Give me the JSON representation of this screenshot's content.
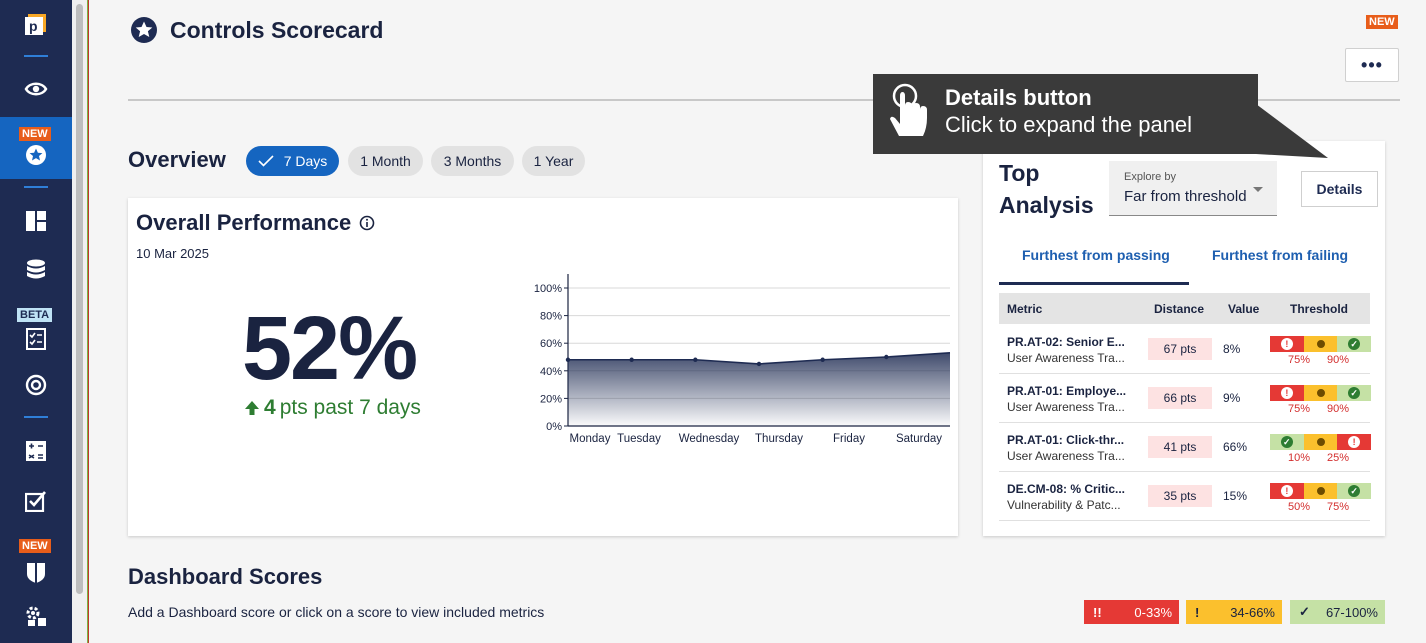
{
  "sidebar": {
    "badges": {
      "new1": "NEW",
      "beta": "BETA",
      "new2": "NEW"
    }
  },
  "header": {
    "title": "Controls Scorecard",
    "new_tag": "NEW",
    "more_label": "•••"
  },
  "overview": {
    "label": "Overview",
    "ranges": [
      "7 Days",
      "1 Month",
      "3 Months",
      "1 Year"
    ],
    "selected": "7 Days"
  },
  "performance": {
    "title": "Overall Performance",
    "date": "10 Mar 2025",
    "score": "52%",
    "delta_value": "4",
    "delta_text": "pts past 7 days"
  },
  "chart_data": {
    "type": "area",
    "categories": [
      "Monday",
      "Tuesday",
      "Wednesday",
      "Thursday",
      "Friday",
      "Saturday"
    ],
    "values": [
      48,
      48,
      48,
      45,
      48,
      50,
      53
    ],
    "ylim": [
      0,
      100
    ],
    "yticks": [
      "0%",
      "20%",
      "40%",
      "60%",
      "80%",
      "100%"
    ],
    "grid": true,
    "color": "#1e2b52"
  },
  "top_analysis": {
    "title_line1": "Top",
    "title_line2": "Analysis",
    "explore_label": "Explore by",
    "explore_value": "Far from threshold",
    "details_label": "Details",
    "tabs": [
      "Furthest from passing",
      "Furthest from failing"
    ],
    "columns": [
      "Metric",
      "Distance",
      "Value",
      "Threshold"
    ],
    "rows": [
      {
        "metric": "PR.AT-02: Senior E...",
        "category": "User Awareness Tra...",
        "distance": "67 pts",
        "value": "8%",
        "order": [
          "r",
          "y",
          "g"
        ],
        "low": "75%",
        "high": "90%"
      },
      {
        "metric": "PR.AT-01: Employe...",
        "category": "User Awareness Tra...",
        "distance": "66 pts",
        "value": "9%",
        "order": [
          "r",
          "y",
          "g"
        ],
        "low": "75%",
        "high": "90%"
      },
      {
        "metric": "PR.AT-01: Click-thr...",
        "category": "User Awareness Tra...",
        "distance": "41 pts",
        "value": "66%",
        "order": [
          "g",
          "y",
          "r"
        ],
        "low": "10%",
        "high": "25%"
      },
      {
        "metric": "DE.CM-08: % Critic...",
        "category": "Vulnerability & Patc...",
        "distance": "35 pts",
        "value": "15%",
        "order": [
          "r",
          "y",
          "g"
        ],
        "low": "50%",
        "high": "75%"
      }
    ]
  },
  "tooltip": {
    "line1": "Details button",
    "line2": "Click to expand the panel"
  },
  "dashboard": {
    "title": "Dashboard Scores",
    "subtitle": "Add a Dashboard score or click on a score to view included metrics",
    "legend": [
      {
        "icon": "!!",
        "label": "0-33%",
        "color": "#e53935"
      },
      {
        "icon": "!",
        "label": "34-66%",
        "color": "#fbc02d"
      },
      {
        "icon": "✓",
        "label": "67-100%",
        "color": "#c5e1a5"
      }
    ]
  }
}
